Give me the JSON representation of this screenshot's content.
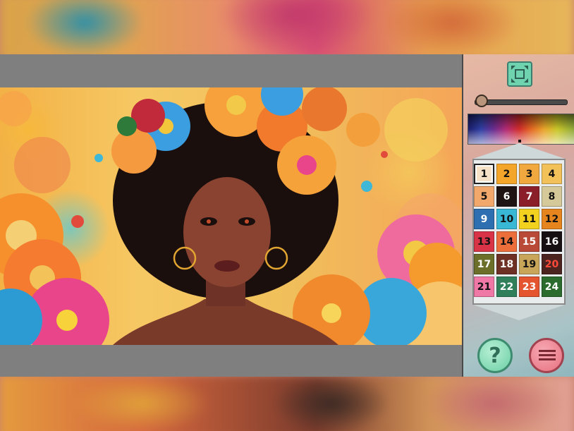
{
  "app": {
    "accent_green": "#6fd3b0",
    "accent_pink": "#e7707f",
    "canvas_background": "#7f7f7f"
  },
  "artwork": {
    "subject": "colorful illustration of woman with afro and orange, blue and pink flowers"
  },
  "toolbar": {
    "fullscreen_icon": "fullscreen-icon",
    "zoom_level": 0.05
  },
  "palette": {
    "selected": 1,
    "colors": [
      {
        "number": "1",
        "color": "#f6e2c9",
        "text": "#111111"
      },
      {
        "number": "2",
        "color": "#f4a62a",
        "text": "#111111"
      },
      {
        "number": "3",
        "color": "#f0a83f",
        "text": "#111111"
      },
      {
        "number": "4",
        "color": "#f3c15a",
        "text": "#111111"
      },
      {
        "number": "5",
        "color": "#f2a86a",
        "text": "#111111"
      },
      {
        "number": "6",
        "color": "#1e1413",
        "text": "#ffffff"
      },
      {
        "number": "7",
        "color": "#8a1f2a",
        "text": "#ffffff"
      },
      {
        "number": "8",
        "color": "#d5c99a",
        "text": "#111111"
      },
      {
        "number": "9",
        "color": "#2d6fb0",
        "text": "#ffffff"
      },
      {
        "number": "10",
        "color": "#39b8d6",
        "text": "#111111"
      },
      {
        "number": "11",
        "color": "#f2d21f",
        "text": "#111111"
      },
      {
        "number": "12",
        "color": "#e6851d",
        "text": "#111111"
      },
      {
        "number": "13",
        "color": "#d83346",
        "text": "#111111"
      },
      {
        "number": "14",
        "color": "#ec6e3a",
        "text": "#111111"
      },
      {
        "number": "15",
        "color": "#b84a37",
        "text": "#ffffff"
      },
      {
        "number": "16",
        "color": "#171013",
        "text": "#ffffff"
      },
      {
        "number": "17",
        "color": "#6b6f2a",
        "text": "#ffffff"
      },
      {
        "number": "18",
        "color": "#6e2f24",
        "text": "#ffffff"
      },
      {
        "number": "19",
        "color": "#c9a55a",
        "text": "#111111"
      },
      {
        "number": "20",
        "color": "#4b2420",
        "text": "#ff4a3a"
      },
      {
        "number": "21",
        "color": "#ef78a6",
        "text": "#111111"
      },
      {
        "number": "22",
        "color": "#2f7f5b",
        "text": "#ffffff"
      },
      {
        "number": "23",
        "color": "#e4552f",
        "text": "#ffffff"
      },
      {
        "number": "24",
        "color": "#2c6b2e",
        "text": "#ffffff"
      }
    ]
  },
  "buttons": {
    "help_label": "?",
    "menu_icon": "hamburger-menu-icon"
  }
}
